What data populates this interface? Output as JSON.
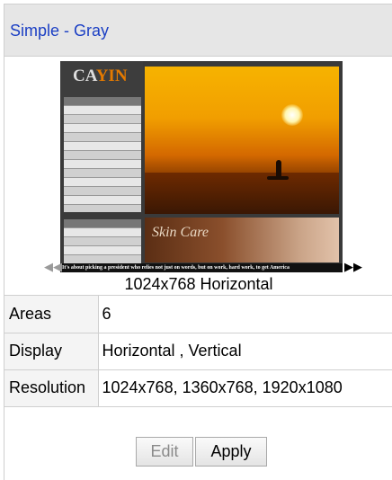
{
  "template": {
    "name": "Simple - Gray",
    "preview_caption": "1024x768 Horizontal",
    "preview_brand": "CAYIN",
    "preview_ticker": "It's about picking a president who relies not just on words, but on work, hard work, to get America"
  },
  "details": [
    {
      "label": "Areas",
      "value": "6"
    },
    {
      "label": "Display",
      "value": "Horizontal , Vertical"
    },
    {
      "label": "Resolution",
      "value": "1024x768, 1360x768, 1920x1080"
    }
  ],
  "buttons": {
    "edit": "Edit",
    "apply": "Apply"
  },
  "icons": {
    "prev": "arrow-left-icon",
    "next": "arrow-right-icon"
  }
}
